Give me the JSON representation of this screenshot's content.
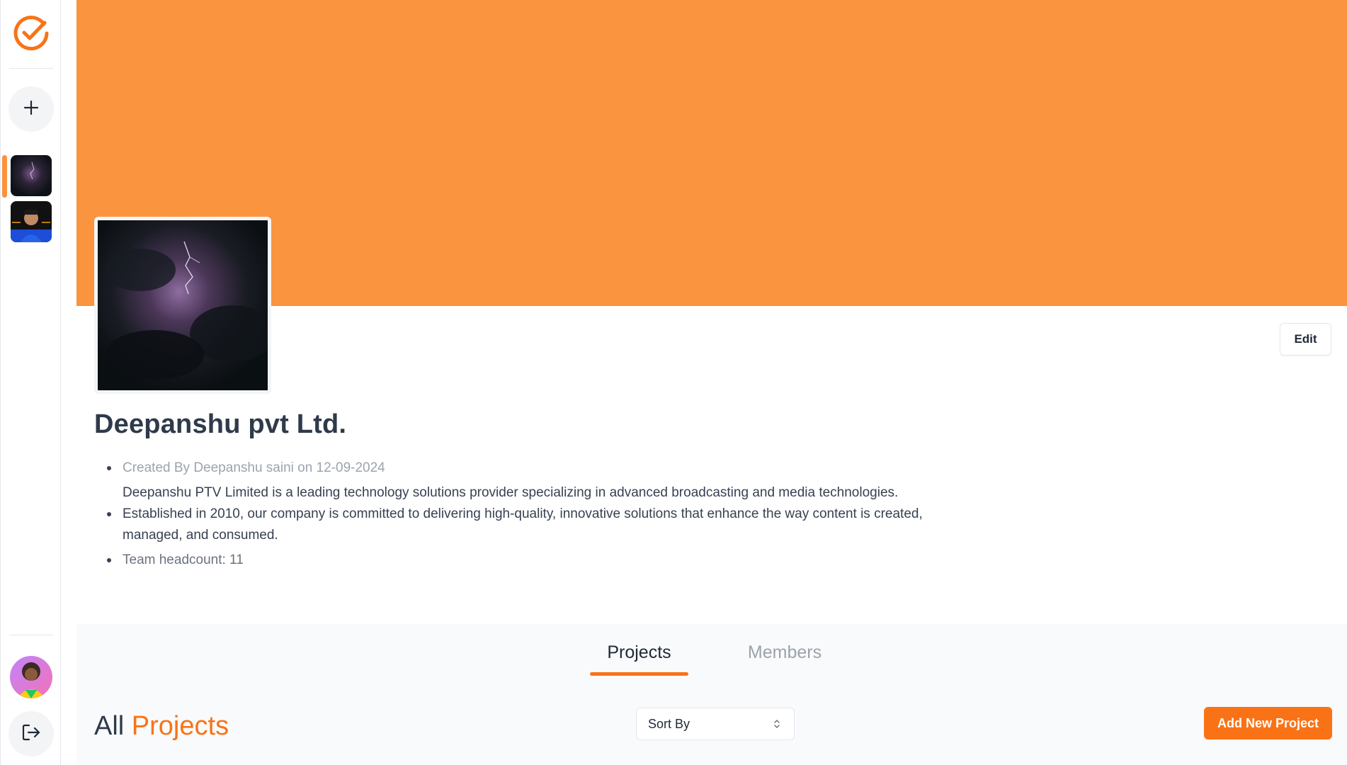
{
  "sidebar": {
    "logo_icon": "check-circle-logo-icon",
    "add_icon": "plus-icon",
    "orgs": [
      {
        "name": "org-storm-thumbnail"
      },
      {
        "name": "org-person-thumbnail"
      }
    ],
    "logout_icon": "logout-icon"
  },
  "banner": {
    "color": "#fb943e"
  },
  "profile": {
    "edit_label": "Edit",
    "org_name": "Deepanshu pvt Ltd.",
    "created_by": "Created By Deepanshu saini on 12-09-2024",
    "description": "Deepanshu PTV Limited is a leading technology solutions provider specializing in advanced broadcasting and media technologies. Established in 2010, our company is committed to delivering high-quality, innovative solutions that enhance the way content is created, managed, and consumed.",
    "headcount": "Team headcount: 11"
  },
  "tabs": {
    "projects": "Projects",
    "members": "Members",
    "active": "Projects"
  },
  "projects": {
    "heading_prefix": "All",
    "heading_accent": "Projects",
    "sort_label": "Sort By",
    "add_button": "Add New Project"
  },
  "colors": {
    "accent": "#f97316",
    "banner": "#fb943e"
  }
}
